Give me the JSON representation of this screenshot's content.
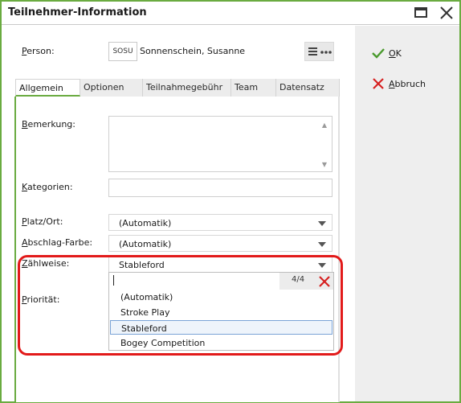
{
  "window": {
    "title": "Teilnehmer-Information"
  },
  "actions": {
    "ok_label": "OK",
    "cancel_label": "Abbruch"
  },
  "person": {
    "label": "Person:",
    "code": "SOSU",
    "name": "Sonnenschein, Susanne"
  },
  "tabs": [
    {
      "label": "Allgemein",
      "active": true
    },
    {
      "label": "Optionen"
    },
    {
      "label": "Teilnahmegebühr"
    },
    {
      "label": "Team"
    },
    {
      "label": "Datensatz"
    }
  ],
  "form": {
    "bemerkung_label": "Bemerkung:",
    "kategorien_label": "Kategorien:",
    "platz_label": "Platz/Ort:",
    "platz_value": "(Automatik)",
    "abschlag_label": "Abschlag-Farbe:",
    "abschlag_value": "(Automatik)",
    "zaehlweise_label": "Zählweise:",
    "zaehlweise_value": "Stableford",
    "prioritaet_label": "Priorität:"
  },
  "dropdown": {
    "count": "4/4",
    "options": [
      "(Automatik)",
      "Stroke Play",
      "Stableford",
      "Bogey Competition"
    ],
    "selected": "Stableford"
  },
  "colors": {
    "accent": "#6aab40",
    "highlight": "#e21a1a",
    "selection": "#7aa3d6"
  }
}
